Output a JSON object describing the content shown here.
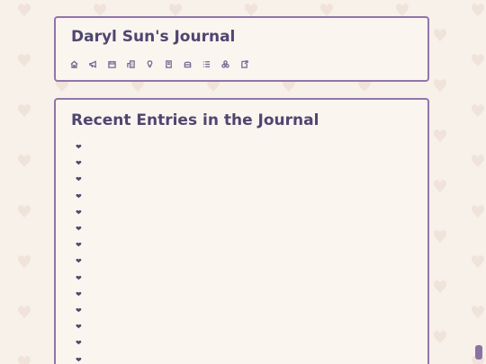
{
  "header": {
    "title": "Daryl Sun's Journal",
    "nav": [
      {
        "icon": "home-icon"
      },
      {
        "icon": "megaphone-icon"
      },
      {
        "icon": "calendar-icon"
      },
      {
        "icon": "buildings-icon"
      },
      {
        "icon": "lightbulb-icon"
      },
      {
        "icon": "book-icon"
      },
      {
        "icon": "archive-icon"
      },
      {
        "icon": "list-icon"
      },
      {
        "icon": "shapes-icon"
      },
      {
        "icon": "external-page-icon"
      }
    ]
  },
  "recent": {
    "title": "Recent Entries in the Journal",
    "entries": [
      {
        "bullet": "❤",
        "label": ""
      },
      {
        "bullet": "❤",
        "label": ""
      },
      {
        "bullet": "❤",
        "label": ""
      },
      {
        "bullet": "❤",
        "label": ""
      },
      {
        "bullet": "❤",
        "label": ""
      },
      {
        "bullet": "❤",
        "label": ""
      },
      {
        "bullet": "❤",
        "label": ""
      },
      {
        "bullet": "❤",
        "label": ""
      },
      {
        "bullet": "❤",
        "label": ""
      },
      {
        "bullet": "❤",
        "label": ""
      },
      {
        "bullet": "❤",
        "label": ""
      },
      {
        "bullet": "❤",
        "label": ""
      },
      {
        "bullet": "❤",
        "label": ""
      },
      {
        "bullet": "❤",
        "label": ""
      }
    ]
  },
  "colors": {
    "background": "#f7f1ea",
    "panel": "#faf5ef",
    "border": "#9275a9",
    "text": "#4f4670",
    "heart_pattern": "#efe3da"
  }
}
